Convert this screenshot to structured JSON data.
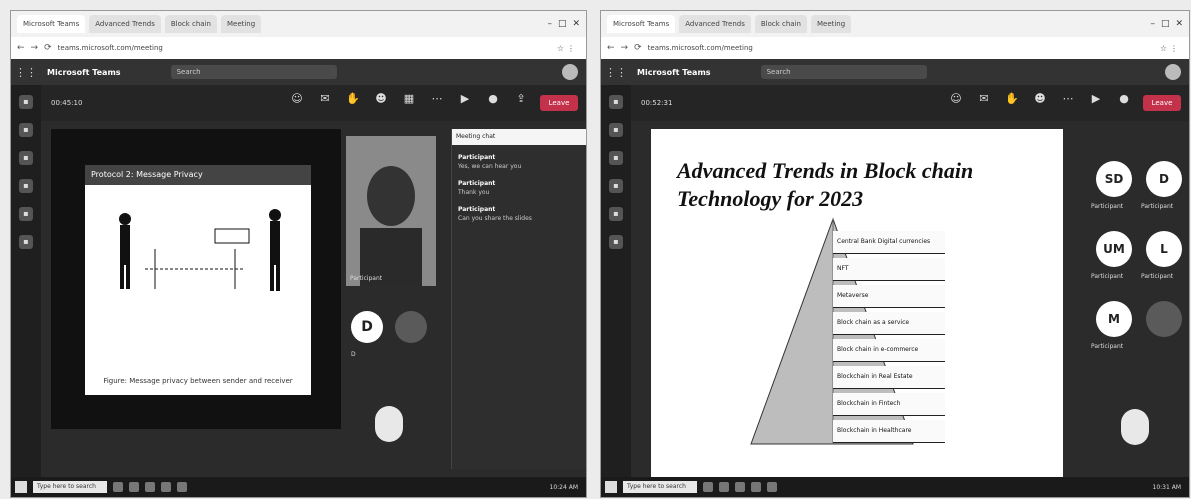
{
  "caption": "",
  "left": {
    "tabs": [
      {
        "label": "Microsoft Teams"
      },
      {
        "label": "Advanced Trends"
      },
      {
        "label": "Block chain"
      },
      {
        "label": "Meeting"
      }
    ],
    "url": "teams.microsoft.com/meeting",
    "app_name": "Microsoft Teams",
    "search_placeholder": "Search",
    "timer": "00:45:10",
    "toolbar_icons": [
      "people-icon",
      "chat-icon",
      "raise-hand-icon",
      "reactions-icon",
      "view-icon",
      "more-icon",
      "camera-icon",
      "mic-icon",
      "share-icon"
    ],
    "leave_label": "Leave",
    "slide_title": "Protocol 2: Message Privacy",
    "slide_caption": "Figure: Message privacy between sender and receiver",
    "participant_main": "Participant",
    "participant_d": "D",
    "participant_d_name": "D",
    "chat_header": "Meeting chat",
    "chat": [
      {
        "who": "Participant",
        "text": "Yes, we can hear you"
      },
      {
        "who": "Participant",
        "text": "Thank you"
      },
      {
        "who": "Participant",
        "text": "Can you share the slides"
      }
    ],
    "bottom_name": "",
    "taskbar_search": "Type here to search",
    "clock": "10:24 AM"
  },
  "right": {
    "tabs": [
      {
        "label": "Microsoft Teams"
      },
      {
        "label": "Advanced Trends"
      },
      {
        "label": "Block chain"
      },
      {
        "label": "Meeting"
      }
    ],
    "url": "teams.microsoft.com/meeting",
    "app_name": "Microsoft Teams",
    "search_placeholder": "Search",
    "timer": "00:52:31",
    "leave_label": "Leave",
    "slide_title": "Advanced Trends in Block chain Technology for 2023",
    "pyramid_items": [
      "Central Bank Digital currencies",
      "NFT",
      "Metaverse",
      "Block chain as a service",
      "Block chain in e-commerce",
      "Blockchain in Real Estate",
      "Blockchain in Fintech",
      "Blockchain in Healthcare"
    ],
    "participants": [
      {
        "initials": "SD",
        "name": "Participant"
      },
      {
        "initials": "D",
        "name": "Participant"
      },
      {
        "initials": "UM",
        "name": "Participant"
      },
      {
        "initials": "L",
        "name": "Participant"
      },
      {
        "initials": "M",
        "name": "Participant"
      }
    ],
    "bottom_name": "",
    "taskbar_search": "Type here to search",
    "clock": "10:31 AM"
  }
}
